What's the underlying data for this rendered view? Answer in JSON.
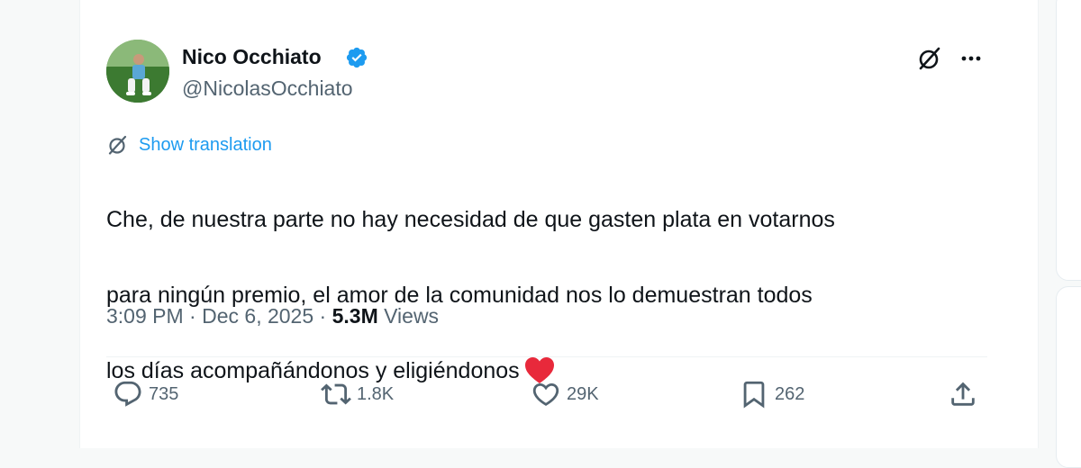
{
  "author": {
    "name": "Nico Occhiato",
    "handle": "@NicolasOcchiato"
  },
  "translation": {
    "label": "Show translation"
  },
  "tweet": {
    "line1": "Che, de nuestra parte no hay necesidad de que gasten plata en votarnos",
    "line2": "para ningún premio, el amor de la comunidad nos lo demuestran todos",
    "line3": "los días acompañándonos y eligiéndonos"
  },
  "meta": {
    "time": "3:09 PM",
    "separator1": " · ",
    "date": "Dec 6, 2025",
    "separator2": " · ",
    "views_count": "5.3M",
    "views_label": " Views"
  },
  "actions": {
    "replies": "735",
    "reposts": "1.8K",
    "likes": "29K",
    "bookmarks": "262"
  },
  "icons": {
    "verified": "verified-badge-icon",
    "grok": "grok-icon",
    "more": "more-dots-icon",
    "translate": "grok-translate-icon",
    "heart_emoji": "red-heart-emoji",
    "reply": "reply-icon",
    "repost": "repost-icon",
    "like": "like-heart-icon",
    "bookmark": "bookmark-icon",
    "share": "share-icon"
  },
  "colors": {
    "link": "#1d9bf0",
    "secondary_text": "#536471",
    "primary_text": "#0f1419",
    "verified": "#1d9bf0",
    "heart_emoji": "#e8293b"
  }
}
